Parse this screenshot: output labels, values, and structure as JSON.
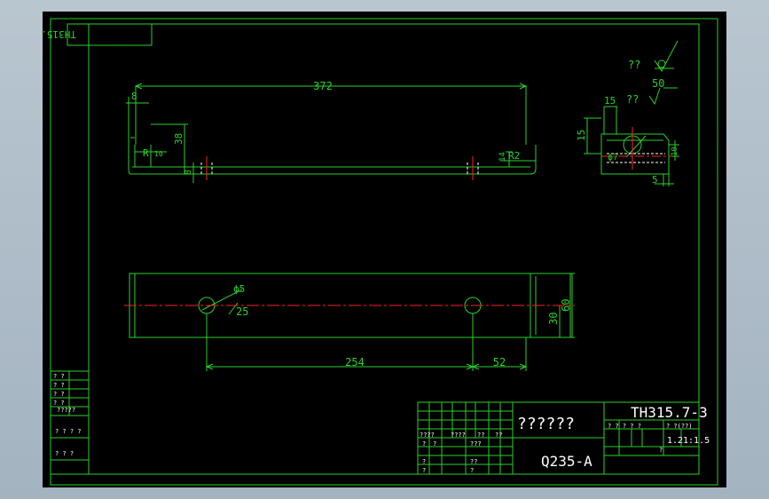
{
  "drawing": {
    "stamp_mirrored": "TH315.7-3",
    "drawing_number": "TH315.7-3",
    "part_name": "??????",
    "material": "Q235-A",
    "scale_values": [
      "1.2",
      "1:1.5"
    ],
    "title_block_small": [
      "????",
      "????",
      "??",
      "??",
      "???",
      "?",
      "?",
      "?",
      "?",
      "?",
      "??",
      "?",
      "? ? ? ? ?",
      "? ?(??)"
    ],
    "revision_block": [
      "? ?",
      "? ?",
      "? ?",
      "? ?",
      "?????",
      "? ? ? ?",
      "? ? ?"
    ]
  },
  "dimensions": {
    "top_length": "372",
    "top_left_offset": "8",
    "top_height": "38",
    "top_R": "R",
    "top_R_small": "10",
    "top_thickness": "8",
    "right_R": "R2",
    "right_14": "14",
    "plan_hole_dia": "ϕ5",
    "plan_hole_depth": "25",
    "plan_spacing": "254",
    "plan_edge": "52",
    "plan_width_30": "30",
    "plan_width_60": "60",
    "detail_15_top": "15",
    "detail_15_side": "15",
    "detail_dia": "ϕ7",
    "detail_5": "5",
    "detail_10": "10"
  },
  "surface": {
    "label_1": "??",
    "label_2": "??",
    "roughness": "50"
  },
  "colors": {
    "frame": "#2bd12b",
    "geometry": "#2bd12b",
    "dimensions": "#2bd12b",
    "centerline": "#ff2020",
    "hidden": "#ffffff",
    "text_white": "#ffffff",
    "background": "#000000"
  }
}
